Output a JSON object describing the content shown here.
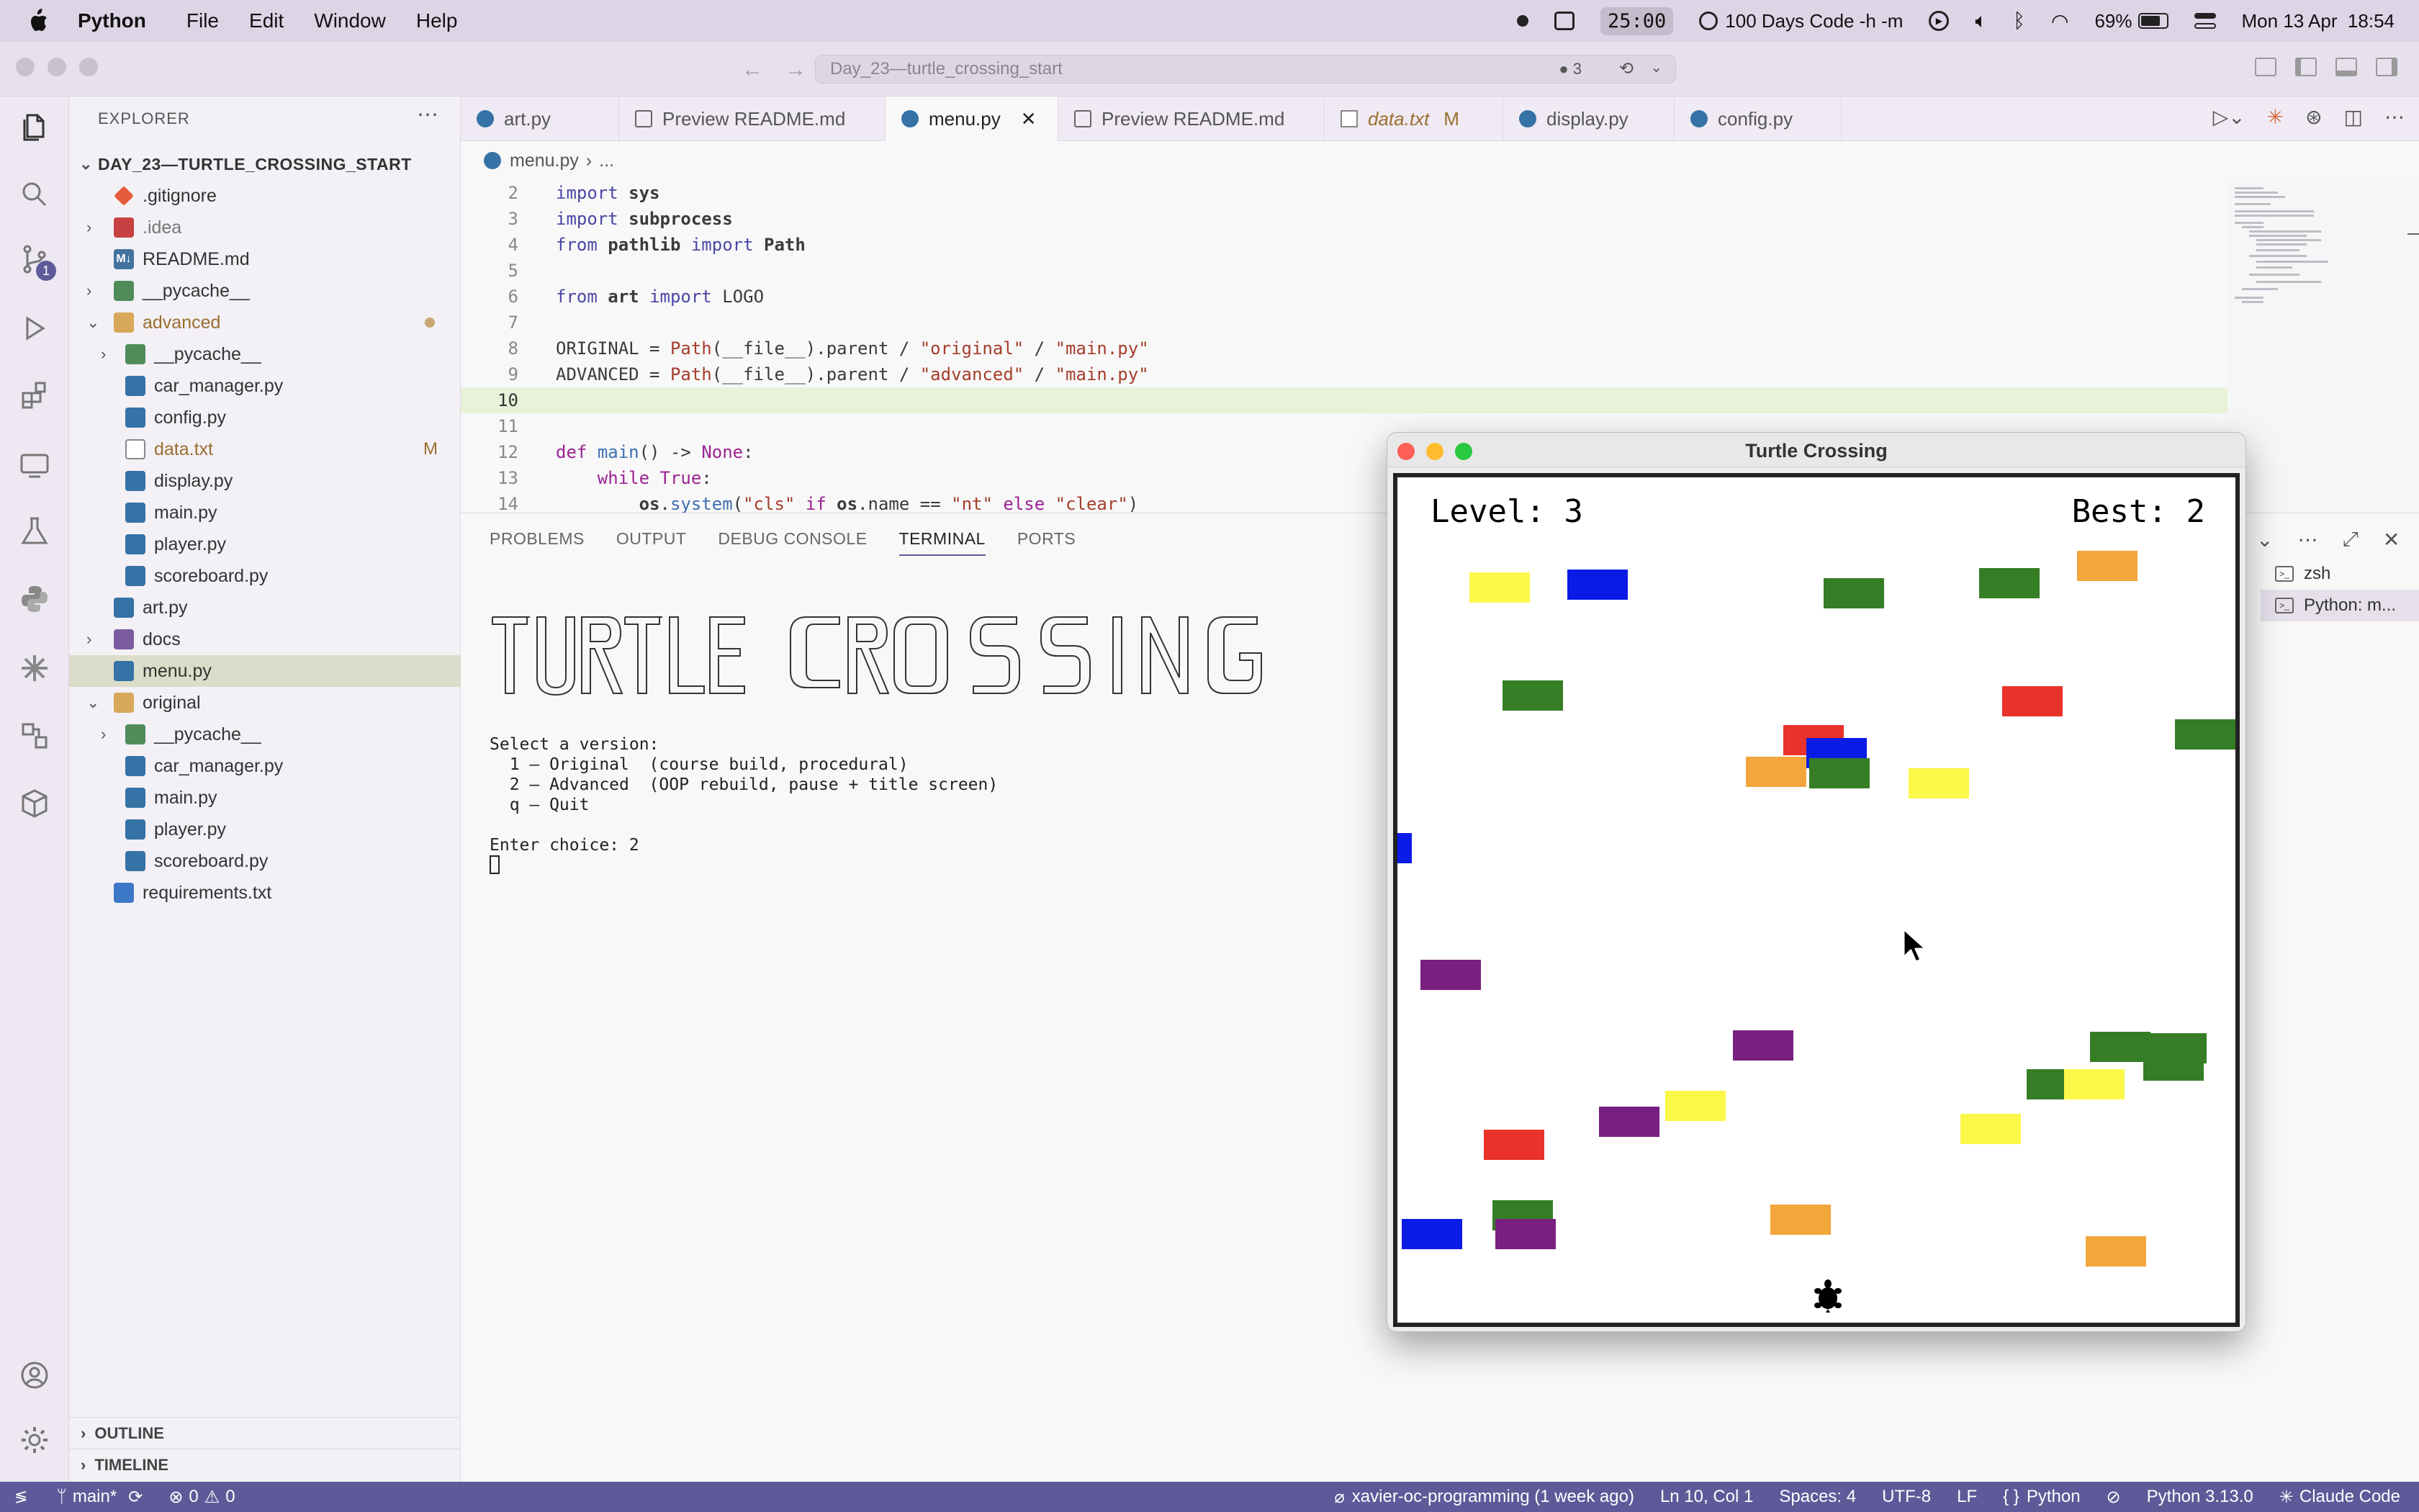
{
  "menubar": {
    "app": "Python",
    "items": [
      "File",
      "Edit",
      "Window",
      "Help"
    ],
    "timer": "25:00",
    "habit": "100 Days Code -h -m",
    "battery": "69%",
    "datetime": "Mon 13 Apr  18:54"
  },
  "titlebar": {
    "search_text": "Day_23—turtle_crossing_start",
    "badge": "3"
  },
  "activity": {
    "scm_badge": "1"
  },
  "sidebar": {
    "title": "EXPLORER",
    "root": "DAY_23—TURTLE_CROSSING_START",
    "items": [
      {
        "label": ".gitignore"
      },
      {
        "label": ".idea"
      },
      {
        "label": "README.md"
      },
      {
        "label": "__pycache__"
      },
      {
        "label": "advanced"
      },
      {
        "label": "__pycache__"
      },
      {
        "label": "car_manager.py"
      },
      {
        "label": "config.py"
      },
      {
        "label": "data.txt",
        "badge": "M"
      },
      {
        "label": "display.py"
      },
      {
        "label": "main.py"
      },
      {
        "label": "player.py"
      },
      {
        "label": "scoreboard.py"
      },
      {
        "label": "art.py"
      },
      {
        "label": "docs"
      },
      {
        "label": "menu.py"
      },
      {
        "label": "original"
      },
      {
        "label": "__pycache__"
      },
      {
        "label": "car_manager.py"
      },
      {
        "label": "main.py"
      },
      {
        "label": "player.py"
      },
      {
        "label": "scoreboard.py"
      },
      {
        "label": "requirements.txt"
      }
    ],
    "outline": "OUTLINE",
    "timeline": "TIMELINE"
  },
  "tabs": [
    {
      "label": "art.py"
    },
    {
      "label": "Preview README.md"
    },
    {
      "label": "menu.py"
    },
    {
      "label": "Preview README.md"
    },
    {
      "label": "data.txt",
      "badge": "M"
    },
    {
      "label": "display.py"
    },
    {
      "label": "config.py"
    }
  ],
  "breadcrumb": {
    "file": "menu.py",
    "rest": "..."
  },
  "editor": {
    "line_numbers": [
      "2",
      "3",
      "4",
      "5",
      "6",
      "7",
      "8",
      "9",
      "10",
      "11",
      "12",
      "13",
      "14"
    ]
  },
  "panel": {
    "tabs": [
      "PROBLEMS",
      "OUTPUT",
      "DEBUG CONSOLE",
      "TERMINAL",
      "PORTS"
    ],
    "terminal_lines": [
      "Select a version:",
      "  1 — Original  (course build, procedural)",
      "  2 — Advanced  (OOP rebuild, pause + title screen)",
      "  q — Quit",
      "",
      "Enter choice: 2"
    ],
    "terminals": [
      "zsh",
      "Python: m..."
    ]
  },
  "turtle_window": {
    "title": "Turtle Crossing",
    "level": "Level: 3",
    "best": "Best: 2",
    "colors": {
      "red": "#e8322a",
      "blue": "#0b1be6",
      "green": "#357e26",
      "yellow": "#fbf84a",
      "orange": "#f2a63c",
      "purple": "#781f7f"
    }
  },
  "statusbar": {
    "branch": "main*",
    "errors": "0",
    "warnings": "0",
    "blame": "xavier-oc-programming (1 week ago)",
    "position": "Ln 10, Col 1",
    "spaces": "Spaces: 4",
    "encoding": "UTF-8",
    "eol": "LF",
    "language": "Python",
    "interpreter": "Python 3.13.0",
    "assistant": "Claude Code"
  }
}
